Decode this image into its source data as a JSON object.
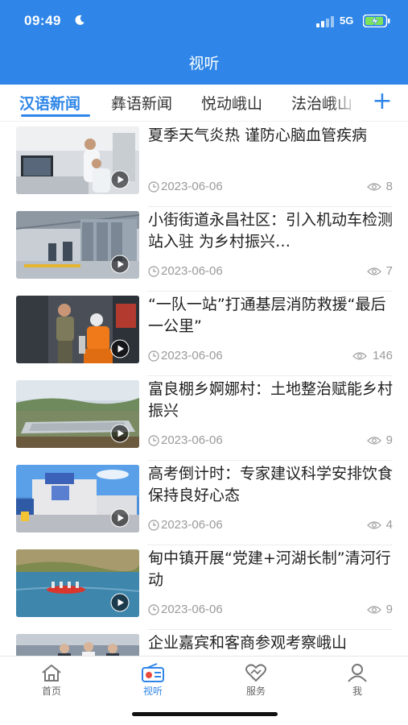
{
  "status": {
    "time": "09:49",
    "network": "5G"
  },
  "header": {
    "title": "视听"
  },
  "tabs": [
    {
      "label": "汉语新闻",
      "active": true
    },
    {
      "label": "彝语新闻",
      "active": false
    },
    {
      "label": "悦动峨山",
      "active": false
    },
    {
      "label": "法治峨山",
      "active": false
    }
  ],
  "add_tab_symbol": "+",
  "news": [
    {
      "title": "夏季天气炎热  谨防心脑血管疾病",
      "date": "2023-06-06",
      "views": "8"
    },
    {
      "title": "小街街道永昌社区：引入机动车检测站入驻  为乡村振兴…",
      "date": "2023-06-06",
      "views": "7"
    },
    {
      "title": "“一队一站”打通基层消防救援“最后一公里”",
      "date": "2023-06-06",
      "views": "146"
    },
    {
      "title": "富良棚乡婀娜村：土地整治赋能乡村振兴",
      "date": "2023-06-06",
      "views": "9"
    },
    {
      "title": "高考倒计时：专家建议科学安排饮食  保持良好心态",
      "date": "2023-06-06",
      "views": "4"
    },
    {
      "title": "甸中镇开展“党建+河湖长制”清河行动",
      "date": "2023-06-06",
      "views": "9"
    },
    {
      "title": "企业嘉宾和客商参观考察峨山",
      "date": "",
      "views": ""
    }
  ],
  "bottom_nav": [
    {
      "label": "首页",
      "icon": "home-icon",
      "active": false
    },
    {
      "label": "视听",
      "icon": "radio-icon",
      "active": true
    },
    {
      "label": "服务",
      "icon": "service-heart-icon",
      "active": false
    },
    {
      "label": "我",
      "icon": "user-icon",
      "active": false
    }
  ],
  "colors": {
    "accent": "#2f86e8",
    "text": "#222222",
    "muted": "#9a9a9a"
  }
}
